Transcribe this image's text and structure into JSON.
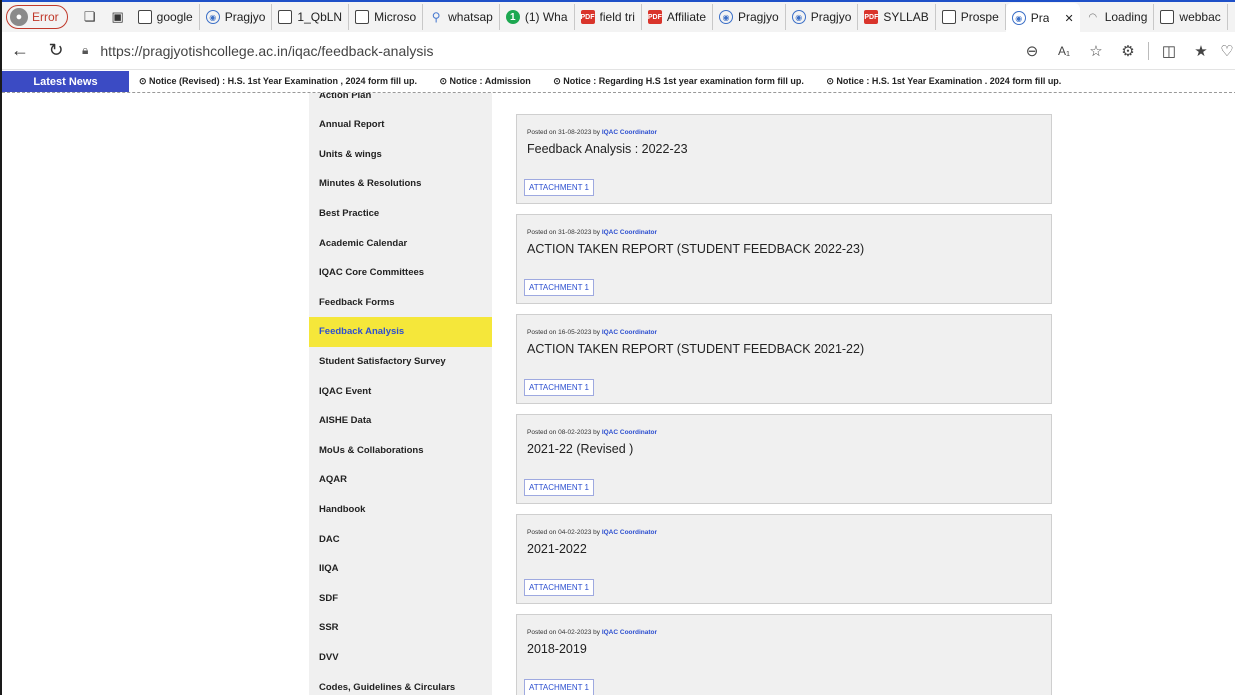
{
  "browser": {
    "profile_label": "Error",
    "tabs": [
      {
        "label": "google",
        "favicon": "doc-icon"
      },
      {
        "label": "Pragjyo",
        "favicon": "globe-icon"
      },
      {
        "label": "1_QbLN",
        "favicon": "doc-icon"
      },
      {
        "label": "Microso",
        "favicon": "doc-icon"
      },
      {
        "label": "whatsap",
        "favicon": "search-icon"
      },
      {
        "label": "(1) Wha",
        "favicon": "whatsapp-icon"
      },
      {
        "label": "field tri",
        "favicon": "pdf-icon"
      },
      {
        "label": "Affiliate",
        "favicon": "pdf-icon"
      },
      {
        "label": "Pragjyo",
        "favicon": "globe-icon"
      },
      {
        "label": "Pragjyo",
        "favicon": "globe-icon"
      },
      {
        "label": "SYLLAB",
        "favicon": "pdf-icon"
      },
      {
        "label": "Prospe",
        "favicon": "doc-icon"
      },
      {
        "label": "Pra",
        "favicon": "globe-icon"
      },
      {
        "label": "Loading",
        "favicon": "loading-icon"
      },
      {
        "label": "webbac",
        "favicon": "doc-icon"
      }
    ],
    "active_tab_close": "✕",
    "url": "https://pragjyotishcollege.ac.in/iqac/feedback-analysis"
  },
  "news": {
    "label": "Latest News",
    "items": [
      "Notice (Revised) : H.S. 1st Year Examination , 2024 form fill up.",
      "Notice : Admission",
      "Notice : Regarding H.S 1st year examination form fill up.",
      "Notice : H.S. 1st Year Examination . 2024 form fill up."
    ]
  },
  "sidebar": {
    "items": [
      "Action Plan",
      "Annual Report",
      "Units & wings",
      "Minutes & Resolutions",
      "Best Practice",
      "Academic Calendar",
      "IQAC Core Committees",
      "Feedback Forms",
      "Feedback Analysis",
      "Student Satisfactory Survey",
      "IQAC Event",
      "AISHE Data",
      "MoUs & Collaborations",
      "AQAR",
      "Handbook",
      "DAC",
      "IIQA",
      "SDF",
      "SSR",
      "DVV",
      "Codes, Guidelines & Circulars"
    ],
    "active": "Feedback Analysis"
  },
  "posts": [
    {
      "posted_prefix": "Posted on 31-08-2023 by",
      "author": "IQAC Coordinator",
      "title": "Feedback Analysis : 2022-23",
      "attachment": "ATTACHMENT 1"
    },
    {
      "posted_prefix": "Posted on 31-08-2023 by",
      "author": "IQAC Coordinator",
      "title": "ACTION TAKEN REPORT (STUDENT FEEDBACK 2022-23)",
      "attachment": "ATTACHMENT 1"
    },
    {
      "posted_prefix": "Posted on 16-05-2023 by",
      "author": "IQAC Coordinator",
      "title": "ACTION TAKEN REPORT (STUDENT FEEDBACK 2021-22)",
      "attachment": "ATTACHMENT 1"
    },
    {
      "posted_prefix": "Posted on 08-02-2023 by",
      "author": "IQAC Coordinator",
      "title": "2021-22 (Revised )",
      "attachment": "ATTACHMENT 1"
    },
    {
      "posted_prefix": "Posted on 04-02-2023 by",
      "author": "IQAC Coordinator",
      "title": "2021-2022",
      "attachment": "ATTACHMENT 1"
    },
    {
      "posted_prefix": "Posted on 04-02-2023 by",
      "author": "IQAC Coordinator",
      "title": "2018-2019",
      "attachment": "ATTACHMENT 1"
    }
  ]
}
